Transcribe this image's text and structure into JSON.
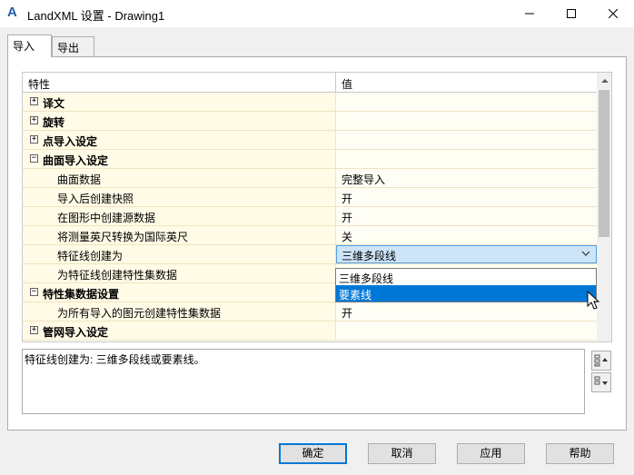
{
  "window": {
    "app_icon": "A",
    "title": "LandXML 设置 - Drawing1"
  },
  "tabs": [
    {
      "label": "导入",
      "active": true
    },
    {
      "label": "导出",
      "active": false
    }
  ],
  "grid": {
    "headers": {
      "property": "特性",
      "value": "值"
    },
    "rows": [
      {
        "type": "category",
        "expander": "+",
        "label": "译文",
        "value": ""
      },
      {
        "type": "category",
        "expander": "+",
        "label": "旋转",
        "value": ""
      },
      {
        "type": "category",
        "expander": "+",
        "label": "点导入设定",
        "value": ""
      },
      {
        "type": "category",
        "expander": "−",
        "label": "曲面导入设定",
        "value": ""
      },
      {
        "type": "child",
        "label": "曲面数据",
        "value": "完整导入"
      },
      {
        "type": "child",
        "label": "导入后创建快照",
        "value": "开"
      },
      {
        "type": "child",
        "label": "在图形中创建源数据",
        "value": "开"
      },
      {
        "type": "child",
        "label": "将测量英尺转换为国际英尺",
        "value": "关"
      },
      {
        "type": "child-selected",
        "label": "特征线创建为",
        "value": "三维多段线"
      },
      {
        "type": "child",
        "label": "为特征线创建特性集数据",
        "value": ""
      },
      {
        "type": "category",
        "expander": "−",
        "label": "特性集数据设置",
        "value": ""
      },
      {
        "type": "child",
        "label": "为所有导入的图元创建特性集数据",
        "value": "开"
      },
      {
        "type": "category",
        "expander": "+",
        "label": "管网导入设定",
        "value": ""
      }
    ]
  },
  "dropdown": {
    "options": [
      "三维多段线",
      "要素线"
    ],
    "highlighted_index": 1
  },
  "description": "特征线创建为: 三维多段线或要素线。",
  "buttons": {
    "ok": "确定",
    "cancel": "取消",
    "apply": "应用",
    "help": "帮助"
  },
  "colors": {
    "highlight": "#0078d7",
    "selected_cell": "#cce4f7",
    "category_band": "#fffbe6"
  }
}
